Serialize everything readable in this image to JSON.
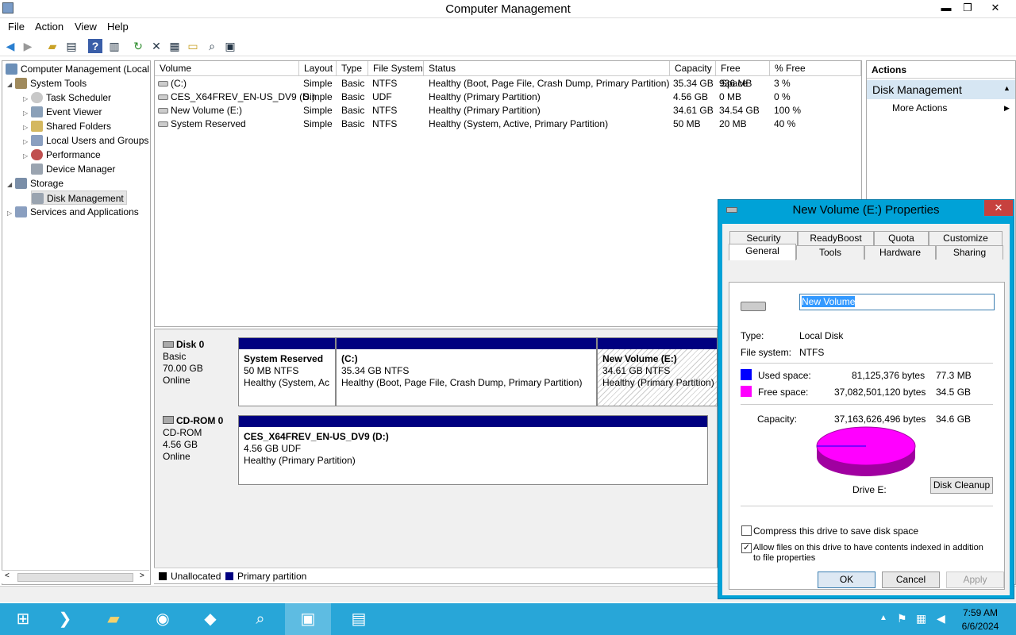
{
  "window": {
    "title": "Computer Management",
    "minimize": "▬",
    "restore": "❐",
    "close": "✕"
  },
  "menu": [
    "File",
    "Action",
    "View",
    "Help"
  ],
  "tree": {
    "root": "Computer Management (Local",
    "system_tools": "System Tools",
    "task_scheduler": "Task Scheduler",
    "event_viewer": "Event Viewer",
    "shared_folders": "Shared Folders",
    "local_users": "Local Users and Groups",
    "performance": "Performance",
    "device_manager": "Device Manager",
    "storage": "Storage",
    "disk_management": "Disk Management",
    "services": "Services and Applications"
  },
  "volumes": {
    "headers": [
      "Volume",
      "Layout",
      "Type",
      "File System",
      "Status",
      "Capacity",
      "Free Space",
      "% Free"
    ],
    "rows": [
      [
        "(C:)",
        "Simple",
        "Basic",
        "NTFS",
        "Healthy (Boot, Page File, Crash Dump, Primary Partition)",
        "35.34 GB",
        "936 MB",
        "3 %"
      ],
      [
        "CES_X64FREV_EN-US_DV9 (D:)",
        "Simple",
        "Basic",
        "UDF",
        "Healthy (Primary Partition)",
        "4.56 GB",
        "0 MB",
        "0 %"
      ],
      [
        "New Volume (E:)",
        "Simple",
        "Basic",
        "NTFS",
        "Healthy (Primary Partition)",
        "34.61 GB",
        "34.54 GB",
        "100 %"
      ],
      [
        "System Reserved",
        "Simple",
        "Basic",
        "NTFS",
        "Healthy (System, Active, Primary Partition)",
        "50 MB",
        "20 MB",
        "40 %"
      ]
    ]
  },
  "disks": {
    "disk0": {
      "name": "Disk 0",
      "kind": "Basic",
      "size": "70.00 GB",
      "state": "Online",
      "p1": {
        "name": "System Reserved",
        "size": "50 MB NTFS",
        "status": "Healthy (System, Ac"
      },
      "p2": {
        "name": "(C:)",
        "size": "35.34 GB NTFS",
        "status": "Healthy (Boot, Page File, Crash Dump, Primary Partition)"
      },
      "p3": {
        "name": "New Volume  (E:)",
        "size": "34.61 GB NTFS",
        "status": "Healthy (Primary Partition)"
      }
    },
    "cdrom0": {
      "name": "CD-ROM 0",
      "kind": "CD-ROM",
      "size": "4.56 GB",
      "state": "Online",
      "p1": {
        "name": "CES_X64FREV_EN-US_DV9  (D:)",
        "size": "4.56 GB UDF",
        "status": "Healthy (Primary Partition)"
      }
    }
  },
  "legend": {
    "unallocated": "Unallocated",
    "primary": "Primary partition",
    "unallocated_color": "#000000",
    "primary_color": "#000080"
  },
  "actions": {
    "header": "Actions",
    "section": "Disk Management",
    "more": "More Actions",
    "collapse": "▲",
    "more_arrow": "▶"
  },
  "dialog": {
    "title": "New Volume (E:) Properties",
    "close": "✕",
    "tabs_row1": [
      "Security",
      "ReadyBoost",
      "Quota",
      "Customize"
    ],
    "tabs_row2": [
      "General",
      "Tools",
      "Hardware",
      "Sharing"
    ],
    "name_value": "New Volume",
    "type_label": "Type:",
    "type_value": "Local Disk",
    "fs_label": "File system:",
    "fs_value": "NTFS",
    "used_label": "Used space:",
    "used_bytes": "81,125,376 bytes",
    "used_gb": "77.3 MB",
    "used_color": "#0000ff",
    "free_label": "Free space:",
    "free_bytes": "37,082,501,120 bytes",
    "free_gb": "34.5 GB",
    "free_color": "#ff00ff",
    "cap_label": "Capacity:",
    "cap_bytes": "37,163,626,496 bytes",
    "cap_gb": "34.6 GB",
    "drive_label": "Drive E:",
    "cleanup": "Disk Cleanup",
    "compress": "Compress this drive to save disk space",
    "index": "Allow files on this drive to have contents indexed in addition to file properties",
    "ok": "OK",
    "cancel": "Cancel",
    "apply": "Apply"
  },
  "clock": {
    "time": "7:59 AM",
    "date": "6/6/2024"
  }
}
